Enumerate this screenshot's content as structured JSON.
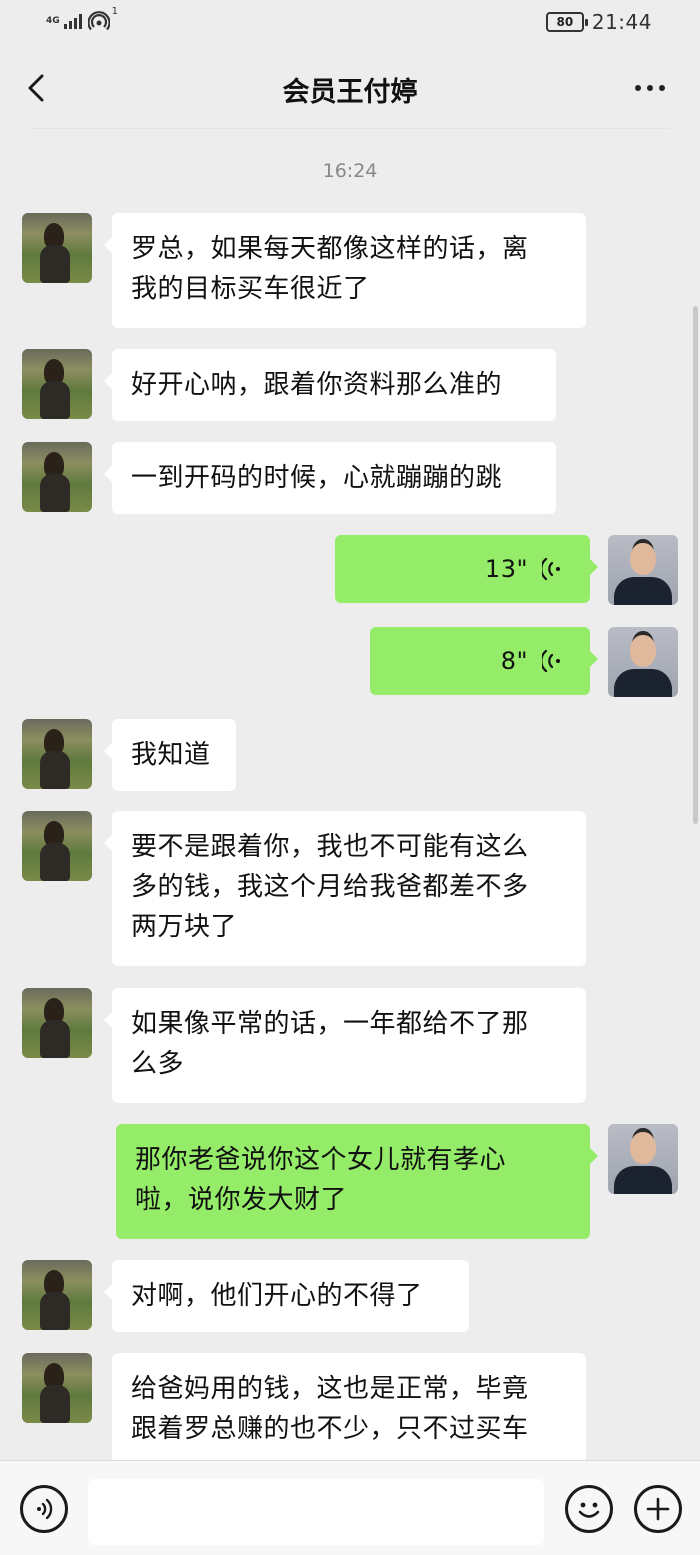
{
  "status_bar": {
    "network": "4G",
    "hotspot_count": "1",
    "battery": "80",
    "time": "21:44"
  },
  "header": {
    "title": "会员王付婷"
  },
  "chat": {
    "timestamp": "16:24",
    "messages": [
      {
        "from": "her",
        "text": "罗总，如果每天都像这样的话，离\n我的目标买车很近了"
      },
      {
        "from": "her",
        "text": "好开心呐，跟着你资料那么准的"
      },
      {
        "from": "her",
        "text": "一到开码的时候，心就蹦蹦的跳"
      },
      {
        "from": "me",
        "type": "voice",
        "duration": "13\""
      },
      {
        "from": "me",
        "type": "voice",
        "duration": "8\""
      },
      {
        "from": "her",
        "text": "我知道"
      },
      {
        "from": "her",
        "text": "要不是跟着你，我也不可能有这么\n多的钱，我这个月给我爸都差不多\n两万块了"
      },
      {
        "from": "her",
        "text": "如果像平常的话，一年都给不了那\n么多"
      },
      {
        "from": "me",
        "text": "那你老爸说你这个女儿就有孝心\n啦，说你发大财了"
      },
      {
        "from": "her",
        "text": "对啊，他们开心的不得了"
      },
      {
        "from": "her",
        "text": "给爸妈用的钱，这也是正常，毕竟\n跟着罗总赚的也不少，只不过买车"
      }
    ]
  },
  "input_bar": {
    "voice_icon": "voice-mode-icon",
    "emoji_icon": "emoji-icon",
    "plus_icon": "plus-icon"
  },
  "colors": {
    "background": "#ededed",
    "incoming_bubble": "#ffffff",
    "outgoing_bubble": "#95ec69"
  }
}
